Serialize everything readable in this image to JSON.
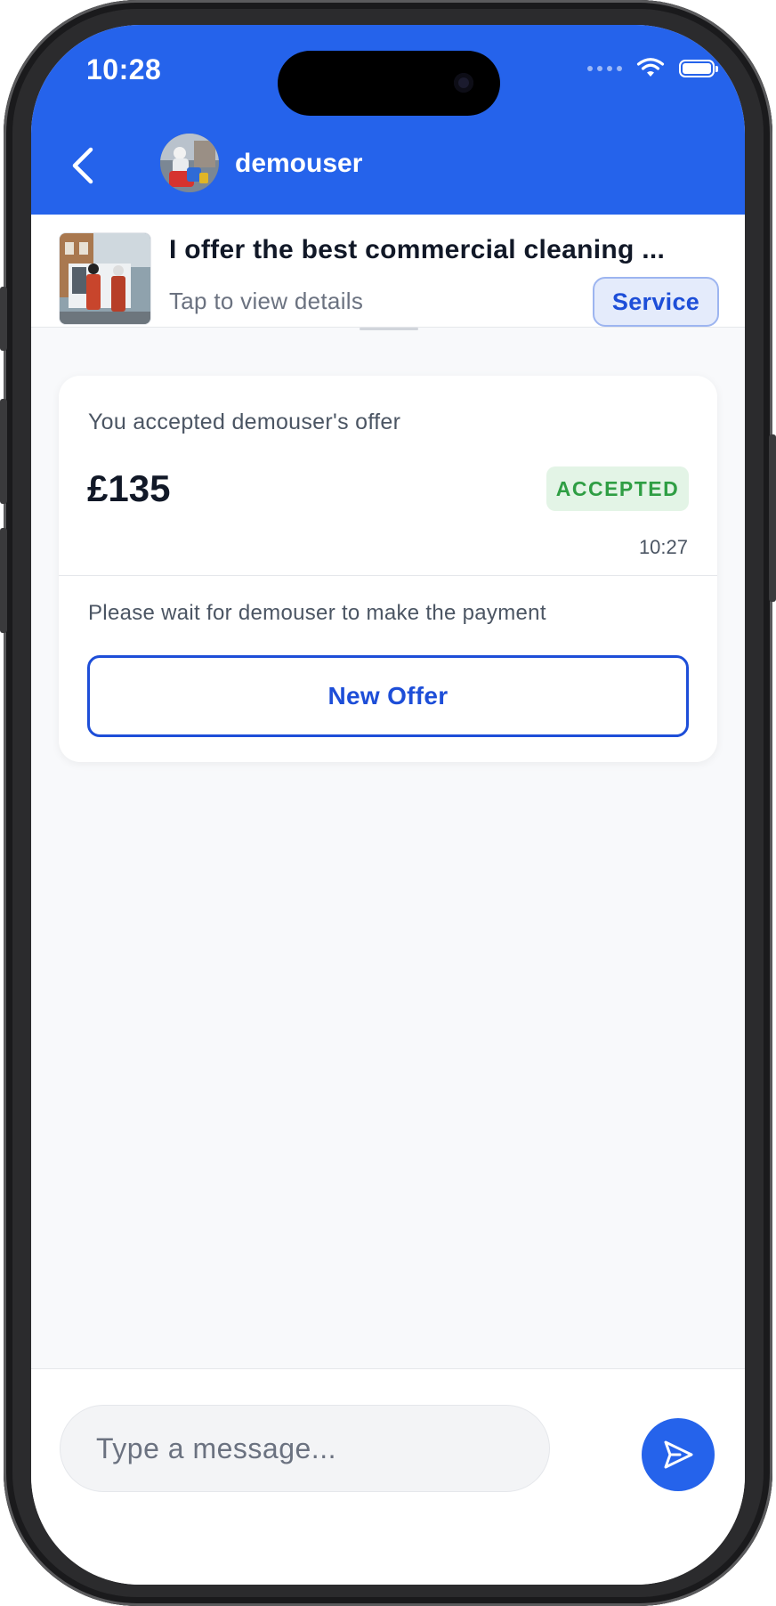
{
  "status_bar": {
    "time": "10:28"
  },
  "header": {
    "username": "demouser"
  },
  "listing": {
    "title": "I offer the best commercial cleaning ...",
    "subtitle": "Tap to view details",
    "badge": "Service"
  },
  "offer": {
    "heading": "You accepted demouser's offer",
    "price": "£135",
    "status": "ACCEPTED",
    "time": "10:27",
    "note": "Please wait for demouser to make the payment",
    "button_label": "New Offer"
  },
  "composer": {
    "placeholder": "Type a message..."
  },
  "colors": {
    "brand": "#2563eb",
    "accepted_bg": "#e3f4e6",
    "accepted_text": "#2f9e44",
    "badge_bg": "#e4ebfb"
  }
}
